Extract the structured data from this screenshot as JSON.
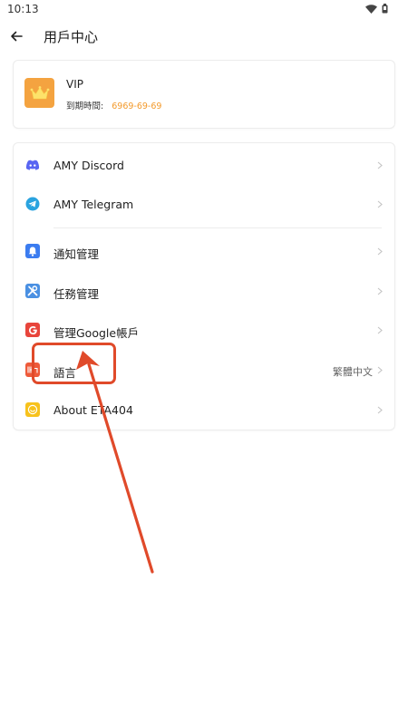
{
  "status_bar": {
    "time": "10:13",
    "icons": [
      "wifi-icon",
      "battery-icon"
    ]
  },
  "header": {
    "title": "用戶中心",
    "back_icon": "arrow-left-icon"
  },
  "vip_card": {
    "title": "VIP",
    "expiry_label": "到期時間:",
    "expiry_value": "6969-69-69",
    "avatar_icon": "crown-icon",
    "colors": {
      "avatar_bg": "#f4a340",
      "expiry": "#f39a2c"
    }
  },
  "menu": {
    "items": [
      {
        "label": "AMY Discord",
        "icon": "discord-icon",
        "color": "#5865f2",
        "value": ""
      },
      {
        "label": "AMY Telegram",
        "icon": "telegram-icon",
        "color": "#2aa3df",
        "value": ""
      },
      {
        "label": "通知管理",
        "icon": "bell-icon",
        "color": "#3b7cf0",
        "value": ""
      },
      {
        "label": "任務管理",
        "icon": "tools-icon",
        "color": "#4a90e2",
        "value": ""
      },
      {
        "label": "管理Google帳戶",
        "icon": "google-icon",
        "color": "#e8453c",
        "value": ""
      },
      {
        "label": "語言",
        "icon": "language-icon",
        "color": "#ee5a3a",
        "value": "繁體中文"
      },
      {
        "label": "About ETA404",
        "icon": "smile-icon",
        "color": "#f7c21c",
        "value": ""
      }
    ]
  },
  "annotation": {
    "color": "#e04a2a",
    "target": "語言"
  }
}
